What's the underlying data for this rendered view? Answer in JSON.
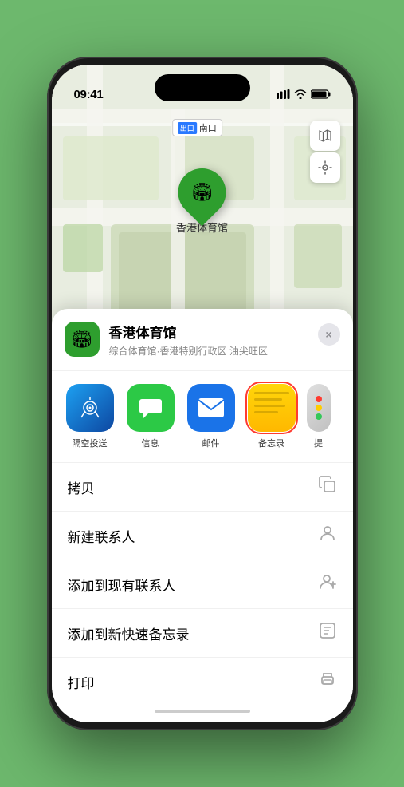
{
  "status_bar": {
    "time": "09:41",
    "signal_icon": "▌▌▌",
    "wifi_icon": "wifi",
    "battery_icon": "battery"
  },
  "map": {
    "label_badge": "出口",
    "label_text": "南口",
    "location_name": "香港体育馆",
    "pin_icon": "🏟"
  },
  "location_card": {
    "title": "香港体育馆",
    "subtitle": "综合体育馆·香港特别行政区 油尖旺区",
    "close_label": "×"
  },
  "share_items": [
    {
      "id": "airdrop",
      "label": "隔空投送",
      "type": "airdrop"
    },
    {
      "id": "messages",
      "label": "信息",
      "type": "messages"
    },
    {
      "id": "mail",
      "label": "邮件",
      "type": "mail"
    },
    {
      "id": "notes",
      "label": "备忘录",
      "type": "notes"
    },
    {
      "id": "more",
      "label": "提",
      "type": "more"
    }
  ],
  "action_items": [
    {
      "id": "copy",
      "label": "拷贝",
      "icon": "⎘"
    },
    {
      "id": "new-contact",
      "label": "新建联系人",
      "icon": "👤"
    },
    {
      "id": "add-contact",
      "label": "添加到现有联系人",
      "icon": "👤+"
    },
    {
      "id": "quick-note",
      "label": "添加到新快速备忘录",
      "icon": "📋"
    },
    {
      "id": "print",
      "label": "打印",
      "icon": "🖨"
    }
  ]
}
